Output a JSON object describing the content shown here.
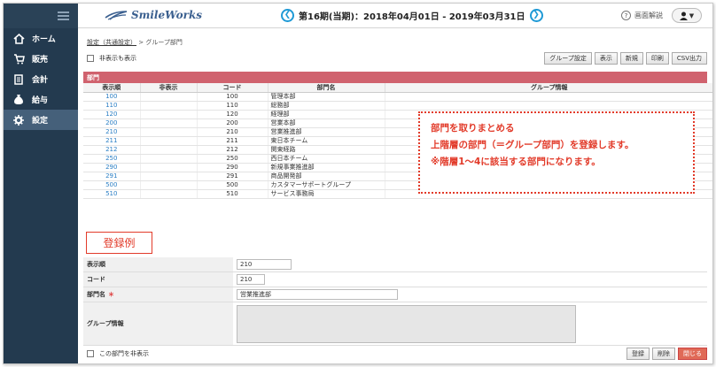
{
  "header": {
    "logo": "SmileWorks",
    "period": "第16期(当期)：2018年04月01日 - 2019年03月31日",
    "prev_icon": "❮",
    "next_icon": "❯",
    "help_label": "画面解説",
    "user_menu": "▼"
  },
  "sidebar": {
    "items": [
      {
        "label": "ホーム",
        "icon": "home-icon"
      },
      {
        "label": "販売",
        "icon": "cart-icon"
      },
      {
        "label": "会計",
        "icon": "ledger-icon"
      },
      {
        "label": "給与",
        "icon": "money-bag-icon"
      },
      {
        "label": "設定",
        "icon": "gear-icon"
      }
    ]
  },
  "breadcrumb": {
    "link": "設定（共通設定）",
    "sep": ">",
    "current": "グループ部門"
  },
  "options": {
    "show_hidden": "非表示も表示"
  },
  "toolbar": {
    "group_settings": "グループ設定",
    "display": "表示",
    "new": "新規",
    "print": "印刷",
    "csv": "CSV出力"
  },
  "table": {
    "title": "部門",
    "headers": [
      "表示順",
      "非表示",
      "コード",
      "部門名",
      "グループ情報"
    ],
    "rows": [
      {
        "order": "100",
        "hidden": "",
        "code": "100",
        "name": "管理本部",
        "group": ""
      },
      {
        "order": "110",
        "hidden": "",
        "code": "110",
        "name": "総務部",
        "group": ""
      },
      {
        "order": "120",
        "hidden": "",
        "code": "120",
        "name": "経理部",
        "group": ""
      },
      {
        "order": "200",
        "hidden": "",
        "code": "200",
        "name": "営業本部",
        "group": ""
      },
      {
        "order": "210",
        "hidden": "",
        "code": "210",
        "name": "営業推進部",
        "group": ""
      },
      {
        "order": "211",
        "hidden": "",
        "code": "211",
        "name": "東日本チーム",
        "group": ""
      },
      {
        "order": "212",
        "hidden": "",
        "code": "212",
        "name": "関東経路",
        "group": ""
      },
      {
        "order": "250",
        "hidden": "",
        "code": "250",
        "name": "西日本チーム",
        "group": ""
      },
      {
        "order": "290",
        "hidden": "",
        "code": "290",
        "name": "新規事業推進部",
        "group": ""
      },
      {
        "order": "291",
        "hidden": "",
        "code": "291",
        "name": "商品開発部",
        "group": ""
      },
      {
        "order": "500",
        "hidden": "",
        "code": "500",
        "name": "カスタマーサポートグループ",
        "group": ""
      },
      {
        "order": "510",
        "hidden": "",
        "code": "510",
        "name": "サービス事務局",
        "group": ""
      }
    ]
  },
  "callout": {
    "line1": "部門を取りまとめる",
    "line2": "上階層の部門（＝グループ部門）を登録します。",
    "line3": "※階層1～4に該当する部門になります。"
  },
  "example_label": "登録例",
  "form": {
    "order_label": "表示順",
    "order_value": "210",
    "code_label": "コード",
    "code_value": "210",
    "name_label": "部門名",
    "required_mark": "＊",
    "name_value": "営業推進部",
    "group_label": "グループ情報",
    "hide_label": "この部門を非表示"
  },
  "actions": {
    "register": "登録",
    "delete": "削除",
    "close": "閉じる"
  },
  "colors": {
    "accent": "#1f9ad6",
    "table_header": "#d0626e",
    "callout": "#e23b2a",
    "sidebar": "#233a4f"
  }
}
